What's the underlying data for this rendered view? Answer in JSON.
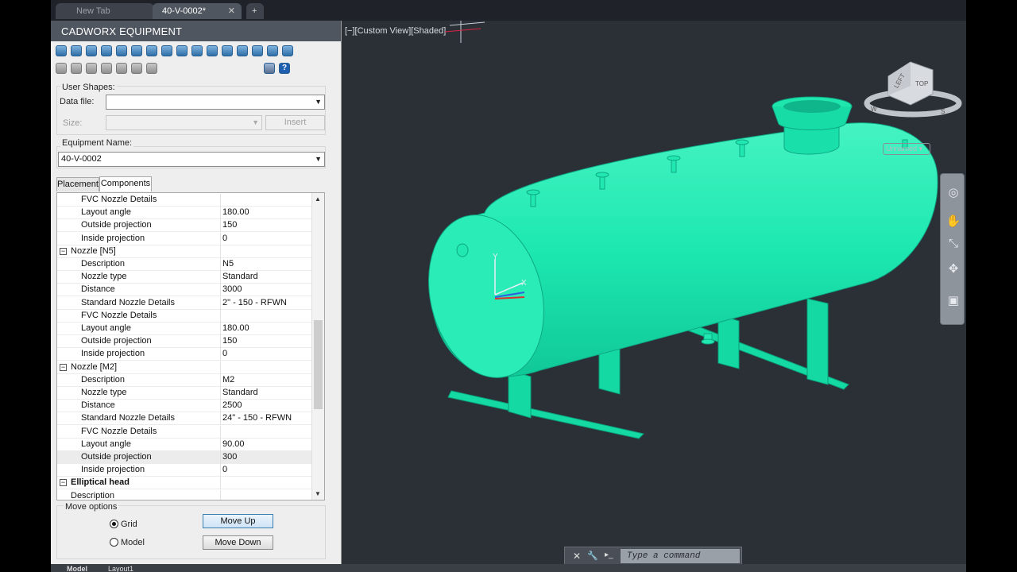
{
  "tabs": {
    "new_tab": "New Tab",
    "active_tab": "40-V-0002*",
    "close": "✕",
    "plus": "+"
  },
  "panel": {
    "title": "CADWORX EQUIPMENT",
    "user_shapes": {
      "legend": "User Shapes:",
      "data_file_label": "Data file:",
      "data_file_value": "",
      "size_label": "Size:",
      "size_value": "",
      "insert": "Insert"
    },
    "equipment_name": {
      "legend": "Equipment Name:",
      "value": "40-V-0002"
    },
    "tabs": {
      "placement": "Placement",
      "components": "Components"
    },
    "rows": [
      {
        "name": "FVC Nozzle Details",
        "value": "",
        "type": "prop"
      },
      {
        "name": "Layout angle",
        "value": "180.00",
        "type": "prop"
      },
      {
        "name": "Outside projection",
        "value": "150",
        "type": "prop"
      },
      {
        "name": "Inside projection",
        "value": "0",
        "type": "prop"
      },
      {
        "name": "Nozzle [N5]",
        "value": "",
        "type": "cat"
      },
      {
        "name": "Description",
        "value": "N5",
        "type": "prop"
      },
      {
        "name": "Nozzle type",
        "value": "Standard",
        "type": "prop"
      },
      {
        "name": "Distance",
        "value": "3000",
        "type": "prop"
      },
      {
        "name": "Standard Nozzle Details",
        "value": "2\" - 150 - RFWN",
        "type": "prop"
      },
      {
        "name": "FVC Nozzle Details",
        "value": "",
        "type": "prop"
      },
      {
        "name": "Layout angle",
        "value": "180.00",
        "type": "prop"
      },
      {
        "name": "Outside projection",
        "value": "150",
        "type": "prop"
      },
      {
        "name": "Inside projection",
        "value": "0",
        "type": "prop"
      },
      {
        "name": "Nozzle [M2]",
        "value": "",
        "type": "cat"
      },
      {
        "name": "Description",
        "value": "M2",
        "type": "prop"
      },
      {
        "name": "Nozzle type",
        "value": "Standard",
        "type": "prop"
      },
      {
        "name": "Distance",
        "value": "2500",
        "type": "prop"
      },
      {
        "name": "Standard Nozzle Details",
        "value": "24\" - 150 - RFWN",
        "type": "prop"
      },
      {
        "name": "FVC Nozzle Details",
        "value": "",
        "type": "prop"
      },
      {
        "name": "Layout angle",
        "value": "90.00",
        "type": "prop"
      },
      {
        "name": "Outside projection",
        "value": "300",
        "type": "prop",
        "selected": true
      },
      {
        "name": "Inside projection",
        "value": "0",
        "type": "prop"
      },
      {
        "name": "Elliptical head",
        "value": "",
        "type": "cat",
        "bold": true
      },
      {
        "name": "Description",
        "value": "",
        "type": "prop",
        "indent": "cat"
      }
    ],
    "move_options": {
      "legend": "Move options",
      "grid": "Grid",
      "model": "Model",
      "move_up": "Move Up",
      "move_down": "Move Down",
      "selected": "Grid"
    }
  },
  "viewport": {
    "label": "[−][Custom View][Shaded]",
    "viewcube": {
      "left": "LEFT",
      "top": "TOP",
      "compass_w": "W",
      "compass_s": "S"
    },
    "named_view": "Unnamed",
    "vessel_color": "#1de8b0",
    "ucs": {
      "x": "X",
      "y": "Y"
    }
  },
  "command": {
    "placeholder": "Type a command",
    "close": "✕",
    "settings": "🔧"
  },
  "status": {
    "model": "Model",
    "layout1": "Layout1"
  }
}
